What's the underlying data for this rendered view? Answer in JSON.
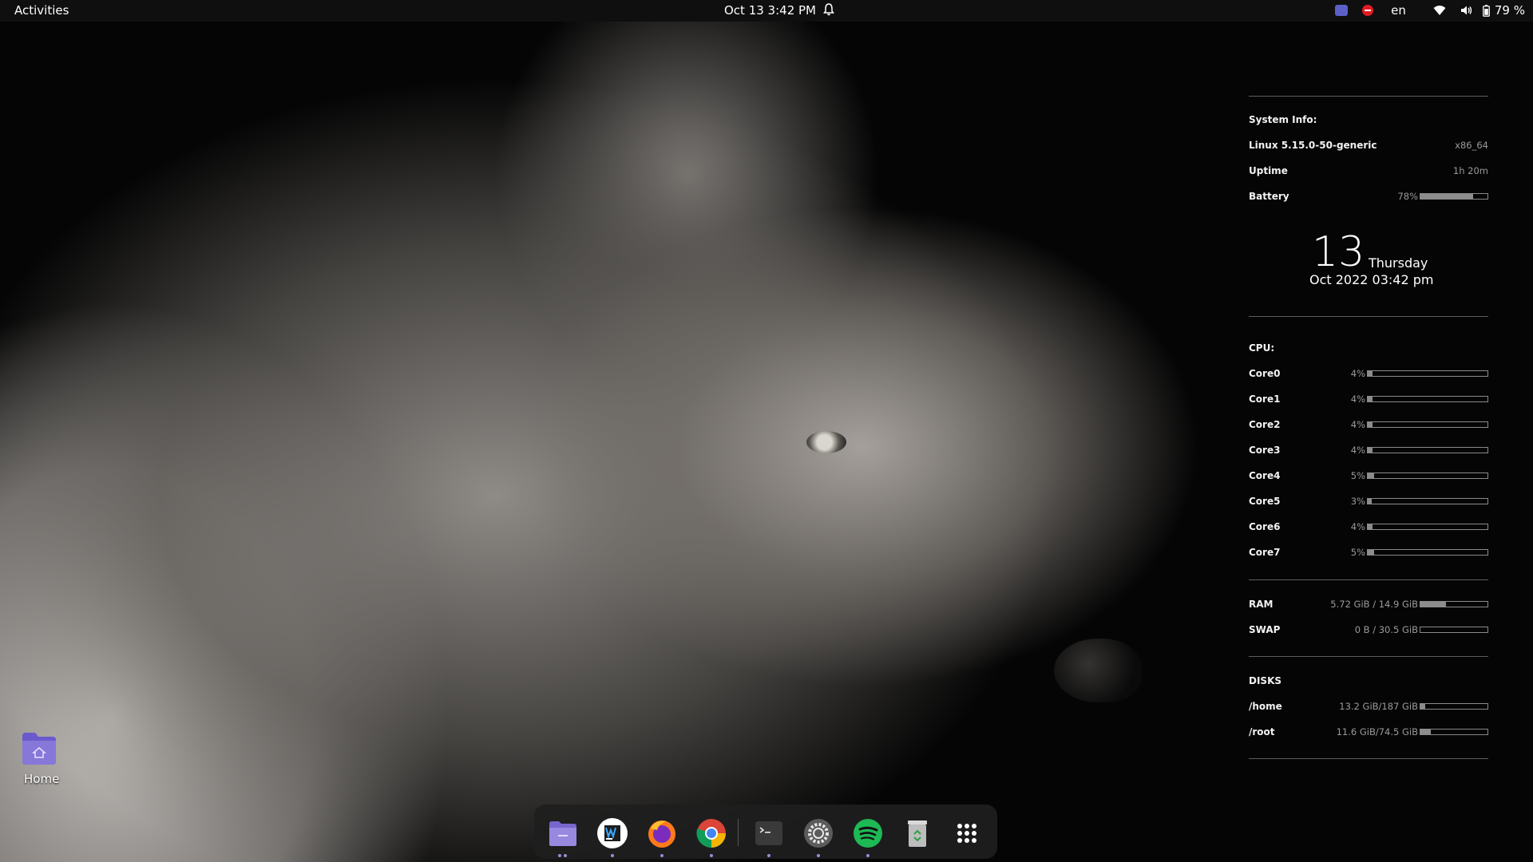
{
  "topbar": {
    "activities": "Activities",
    "clock": "Oct 13  3:42 PM",
    "language": "en",
    "battery": "79 %",
    "icons": [
      "bell-icon",
      "teams-icon",
      "do-not-disturb-icon",
      "wifi-icon",
      "volume-icon",
      "battery-icon"
    ]
  },
  "conky": {
    "system_title": "System Info:",
    "kernel_label": "Linux 5.15.0-50-generic",
    "arch": "x86_64",
    "uptime_label": "Uptime",
    "uptime_value": "1h 20m",
    "battery_label": "Battery",
    "battery_value": "78%",
    "battery_fraction": 0.78,
    "day_number": "13",
    "weekday": "Thursday",
    "date_time": "Oct 2022 03:42 pm",
    "cpu_title": "CPU:",
    "cores": [
      {
        "label": "Core0",
        "value": "4%",
        "fraction": 0.04
      },
      {
        "label": "Core1",
        "value": "4%",
        "fraction": 0.04
      },
      {
        "label": "Core2",
        "value": "4%",
        "fraction": 0.04
      },
      {
        "label": "Core3",
        "value": "4%",
        "fraction": 0.04
      },
      {
        "label": "Core4",
        "value": "5%",
        "fraction": 0.05
      },
      {
        "label": "Core5",
        "value": "3%",
        "fraction": 0.03
      },
      {
        "label": "Core6",
        "value": "4%",
        "fraction": 0.04
      },
      {
        "label": "Core7",
        "value": "5%",
        "fraction": 0.05
      }
    ],
    "ram_label": "RAM",
    "ram_value": "5.72 GiB / 14.9 GiB",
    "ram_fraction": 0.38,
    "swap_label": "SWAP",
    "swap_value": "0 B / 30.5 GiB",
    "swap_fraction": 0.0,
    "disks_title": "DISKS",
    "home_label": "/home",
    "home_value": "13.2 GiB/187 GiB",
    "home_fraction": 0.07,
    "root_label": "/root",
    "root_value": "11.6 GiB/74.5 GiB",
    "root_fraction": 0.16
  },
  "desktop": {
    "home_label": "Home"
  },
  "dock": {
    "apps": [
      "files-icon",
      "webstorm-icon",
      "firefox-icon",
      "chrome-icon",
      "terminal-icon",
      "settings-icon",
      "spotify-icon",
      "trash-icon",
      "show-apps-icon"
    ],
    "accent": "#9b8cd9"
  }
}
